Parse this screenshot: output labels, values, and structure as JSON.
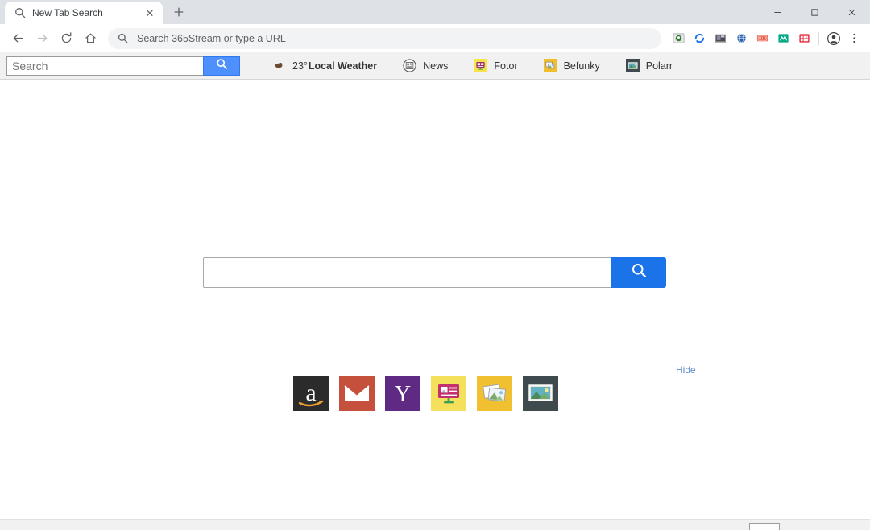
{
  "window": {
    "controls": [
      {
        "name": "minimize",
        "glyph": "–"
      },
      {
        "name": "maximize",
        "glyph": "□"
      },
      {
        "name": "close",
        "glyph": "×"
      }
    ]
  },
  "tabs": [
    {
      "title": "New Tab Search",
      "favicon": "search-icon",
      "close_glyph": "✕"
    }
  ],
  "newtab": {
    "tooltip": "New tab",
    "glyph": "+"
  },
  "nav": {
    "back": "back-arrow-icon",
    "forward": "forward-arrow-icon",
    "reload": "reload-icon",
    "home": "home-icon"
  },
  "omnibox": {
    "placeholder": "Search 365Stream or type a URL",
    "icon": "magnifier-icon"
  },
  "extensions": [
    {
      "name": "extension-1",
      "color": "#3a7a3a"
    },
    {
      "name": "extension-sync",
      "color": "#1a73e8"
    },
    {
      "name": "extension-screen",
      "color": "#4a4a5a"
    },
    {
      "name": "extension-globe",
      "color": "#2b5fa8"
    },
    {
      "name": "extension-coupon",
      "color": "#e8503a"
    },
    {
      "name": "extension-chart",
      "color": "#00a884"
    },
    {
      "name": "extension-calendar",
      "color": "#e8263a"
    }
  ],
  "profile": {
    "name": "profile-avatar"
  },
  "chrome_menu": {
    "name": "three-dot-menu",
    "glyph": "⋮"
  },
  "toolbar": {
    "search": {
      "value": "",
      "placeholder": "Search",
      "button_icon": "magnifier-icon"
    },
    "links": [
      {
        "label_prefix": "23°",
        "label": "Local Weather",
        "icon": "weather-icon",
        "bold": true
      },
      {
        "label_prefix": "",
        "label": "News",
        "icon": "news-icon",
        "bold": false
      },
      {
        "label_prefix": "",
        "label": "Fotor",
        "icon": "fotor-icon",
        "bold": false
      },
      {
        "label_prefix": "",
        "label": "Befunky",
        "icon": "befunky-icon",
        "bold": false
      },
      {
        "label_prefix": "",
        "label": "Polarr",
        "icon": "polarr-icon",
        "bold": false
      }
    ]
  },
  "main": {
    "search": {
      "value": "",
      "placeholder": "",
      "button_icon": "magnifier-icon"
    },
    "hide_label": "Hide",
    "hide_color": "#5b8ccb",
    "shortcuts": [
      {
        "name": "amazon",
        "label": "Amazon",
        "bg": "#2b2b2b"
      },
      {
        "name": "gmail",
        "label": "Gmail",
        "bg": "#c5503c"
      },
      {
        "name": "yahoo",
        "label": "Yahoo",
        "bg": "#5f2a84"
      },
      {
        "name": "slideshow",
        "label": "Slideshow",
        "bg": "#f4e05a"
      },
      {
        "name": "photos",
        "label": "Photos",
        "bg": "#f0c030"
      },
      {
        "name": "gallery",
        "label": "Gallery",
        "bg": "#3e4a4e"
      }
    ]
  },
  "colors": {
    "titlebar": "#dee1e6",
    "toolbar_bg": "#f1f1f1",
    "accent_blue": "#1a73e8",
    "button_blue": "#4d90fe",
    "page_bg": "#ffffff"
  }
}
